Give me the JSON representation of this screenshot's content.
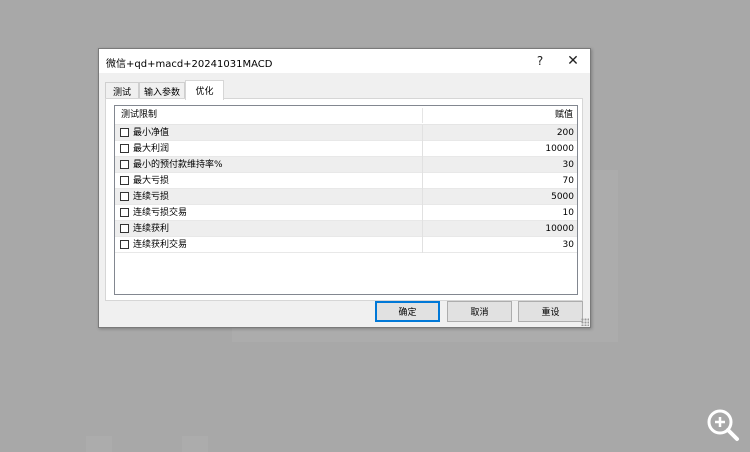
{
  "dialog": {
    "title": "微信+qd+macd+20241031MACD",
    "help_glyph": "?",
    "close_glyph": "✕"
  },
  "tabs": [
    {
      "label": "测试",
      "active": false
    },
    {
      "label": "输入参数",
      "active": false
    },
    {
      "label": "优化",
      "active": true
    }
  ],
  "grid": {
    "columns": {
      "name": "测试限制",
      "value": "赋值"
    },
    "rows": [
      {
        "label": "最小净值",
        "value": "200",
        "checked": false
      },
      {
        "label": "最大利润",
        "value": "10000",
        "checked": false
      },
      {
        "label": "最小的预付款维持率%",
        "value": "30",
        "checked": false
      },
      {
        "label": "最大亏损",
        "value": "70",
        "checked": false
      },
      {
        "label": "连续亏损",
        "value": "5000",
        "checked": false
      },
      {
        "label": "连续亏损交易",
        "value": "10",
        "checked": false
      },
      {
        "label": "连续获利",
        "value": "10000",
        "checked": false
      },
      {
        "label": "连续获利交易",
        "value": "30",
        "checked": false
      }
    ]
  },
  "buttons": {
    "ok": "确定",
    "cancel": "取消",
    "reset": "重设"
  },
  "icons": {
    "zoom": "zoom-in-icon"
  }
}
